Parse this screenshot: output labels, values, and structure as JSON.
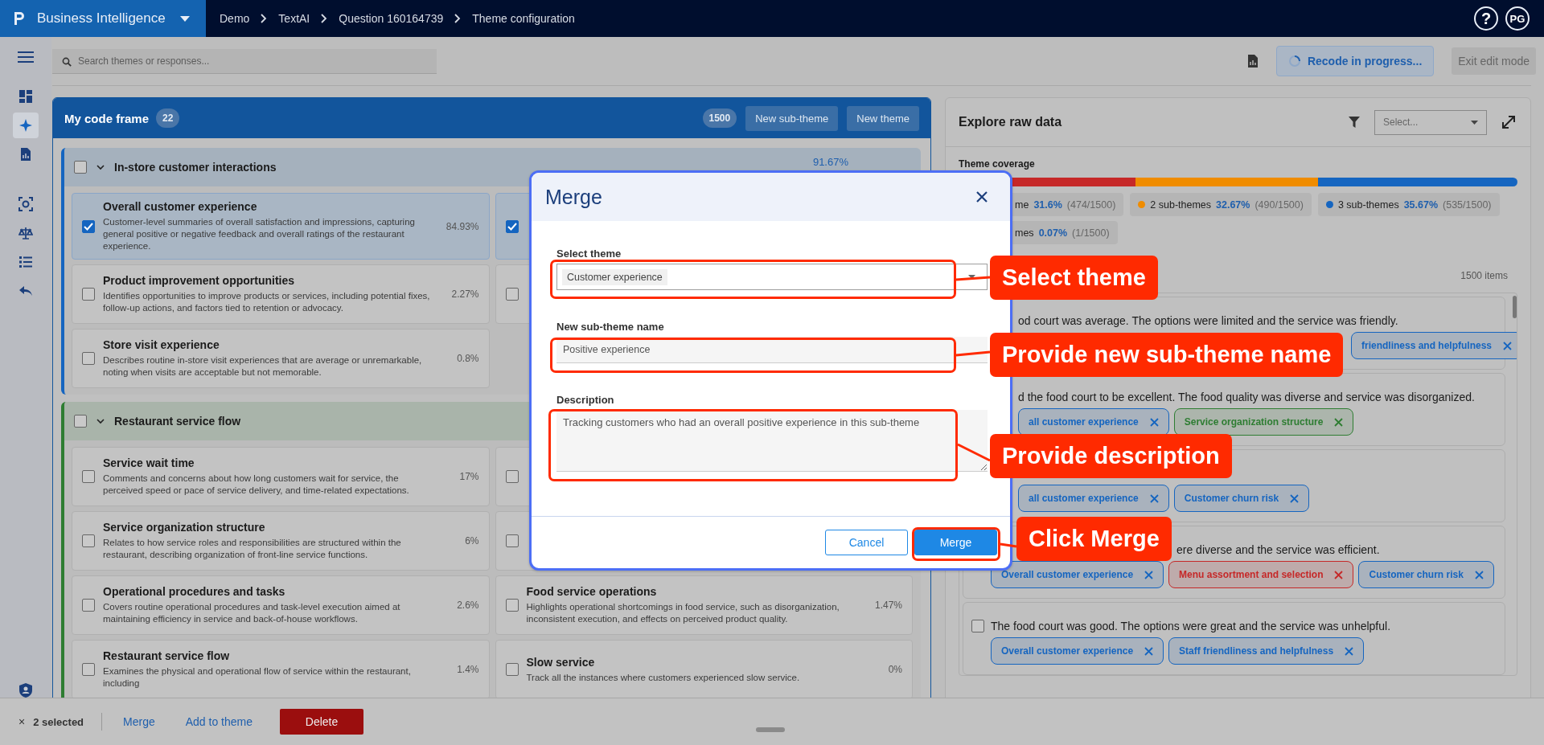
{
  "app": {
    "title": "Business Intelligence"
  },
  "breadcrumbs": [
    "Demo",
    "TextAI",
    "Question 160164739",
    "Theme configuration"
  ],
  "header_actions": {
    "help": "?",
    "user": "PG"
  },
  "sidebar": {
    "items": [
      {
        "kind": "dashboard",
        "selected": false
      },
      {
        "kind": "sparkle",
        "selected": true
      },
      {
        "kind": "report",
        "selected": false
      },
      {
        "kind": "focus",
        "selected": false
      },
      {
        "kind": "scale",
        "selected": false
      },
      {
        "kind": "list",
        "selected": false
      },
      {
        "kind": "back",
        "selected": false
      }
    ]
  },
  "search": {
    "placeholder": "Search themes or responses..."
  },
  "toolbar": {
    "recode": "Recode in progress...",
    "exit": {
      "label": "Exit edit mode",
      "disabled": true
    }
  },
  "code_frame": {
    "title": "My code frame",
    "count": "22",
    "total": "1500",
    "buttons": [
      "New sub-theme",
      "New theme"
    ],
    "groups": [
      {
        "name": "In-store customer interactions",
        "pct": "91.67%",
        "color": "#1565c0",
        "checked": false,
        "expanded": true,
        "themes": [
          {
            "title": "Overall customer experience",
            "desc": "Customer-level summaries of overall satisfaction and impressions, capturing general positive or negative feedback and overall ratings of the restaurant experience.",
            "pct": "84.93%",
            "checked": true
          },
          {
            "checked": true
          },
          {
            "title": "Product improvement opportunities",
            "desc": "Identifies opportunities to improve products or services, including potential fixes, follow-up actions, and factors tied to retention or advocacy.",
            "pct": "2.27%",
            "checked": false
          },
          {
            "checked": false
          },
          {
            "title": "Store visit experience",
            "desc": "Describes routine in-store visit experiences that are average or unremarkable, noting when visits are acceptable but not memorable.",
            "pct": "0.8%",
            "checked": false
          }
        ]
      },
      {
        "name": "Restaurant service flow",
        "color": "#2e7d32",
        "checked": false,
        "expanded": true,
        "themes": [
          {
            "title": "Service wait time",
            "desc": "Comments and concerns about how long customers wait for service, the perceived speed or pace of service delivery, and time-related expectations.",
            "pct": "17%",
            "checked": false
          },
          {
            "checked": false
          },
          {
            "title": "Service organization structure",
            "desc": "Relates to how service roles and responsibilities are structured within the restaurant, describing organization of front-line service functions.",
            "pct": "6%",
            "checked": false
          },
          {
            "checked": false
          },
          {
            "title": "Operational procedures and tasks",
            "desc": "Covers routine operational procedures and task-level execution aimed at maintaining efficiency in service and back-of-house workflows.",
            "pct": "2.6%",
            "checked": false
          },
          {
            "title": "Food service operations",
            "desc": "Highlights operational shortcomings in food service, such as disorganization, inconsistent execution, and effects on perceived product quality.",
            "pct": "1.47%",
            "checked": false
          },
          {
            "title": "Restaurant service flow",
            "desc": "Examines the physical and operational flow of service within the restaurant, including",
            "pct": "1.4%",
            "checked": false
          },
          {
            "title": "Slow service",
            "desc": "Track all the instances where customers experienced slow service.",
            "pct": "0%",
            "checked": false
          }
        ]
      }
    ]
  },
  "explore": {
    "title": "Explore raw data",
    "select_placeholder": "Select...",
    "coverage_label": "Theme coverage",
    "coverage": [
      {
        "label": "me",
        "pct": "31.6%",
        "count": "(474/1500)",
        "color": "#c62828"
      },
      {
        "label": "2 sub-themes",
        "pct": "32.67%",
        "count": "(490/1500)",
        "color": "#ef8c00"
      },
      {
        "label": "3 sub-themes",
        "pct": "35.67%",
        "count": "(535/1500)",
        "color": "#1565c0"
      },
      {
        "label": "mes",
        "pct": "0.07%",
        "count": "(1/1500)"
      }
    ],
    "items_count": "1500 items",
    "responses": [
      {
        "text": "od court was average. The options were limited and the service was friendly.",
        "tags": [
          {
            "label": "friendliness and helpfulness",
            "color": "#1565c0"
          }
        ]
      },
      {
        "text": "d the food court to be excellent. The food quality was diverse and service was disorganized.",
        "tags": [
          {
            "label": "all customer experience",
            "color": "#1565c0"
          },
          {
            "label": "Service organization structure",
            "color": "#2e7d32"
          }
        ]
      },
      {
        "tags": [
          {
            "label": "all customer experience",
            "color": "#1565c0"
          },
          {
            "label": "Customer churn risk",
            "color": "#1565c0"
          }
        ]
      },
      {
        "text": "ere diverse and the service was efficient.",
        "tags": [
          {
            "label": "Overall customer experience",
            "color": "#1565c0"
          },
          {
            "label": "Menu assortment and selection",
            "color": "#c62828"
          },
          {
            "label": "Customer churn risk",
            "color": "#1565c0"
          }
        ]
      },
      {
        "checked": false,
        "text": "The food court was good. The options were great and the service was unhelpful.",
        "tags": [
          {
            "label": "Overall customer experience",
            "color": "#1565c0"
          },
          {
            "label": "Staff friendliness and helpfulness",
            "color": "#1565c0"
          }
        ]
      }
    ]
  },
  "bottom_bar": {
    "clear": "×",
    "selected": "2 selected",
    "actions": [
      "Merge",
      "Add to theme"
    ],
    "delete": "Delete"
  },
  "modal": {
    "title": "Merge",
    "fields": [
      {
        "label": "Select theme",
        "kind": "select",
        "value": "Customer experience"
      },
      {
        "label": "New sub-theme name",
        "kind": "input",
        "value": "Positive experience"
      },
      {
        "label": "Description",
        "kind": "textarea",
        "value": "Tracking customers who had an overall positive experience in this sub-theme"
      }
    ],
    "buttons": [
      {
        "label": "Cancel",
        "kind": "secondary"
      },
      {
        "label": "Merge",
        "kind": "primary"
      }
    ]
  },
  "annotations": [
    {
      "text": "Select theme"
    },
    {
      "text": "Provide new sub-theme name"
    },
    {
      "text": "Provide description"
    },
    {
      "text": "Click Merge"
    }
  ]
}
